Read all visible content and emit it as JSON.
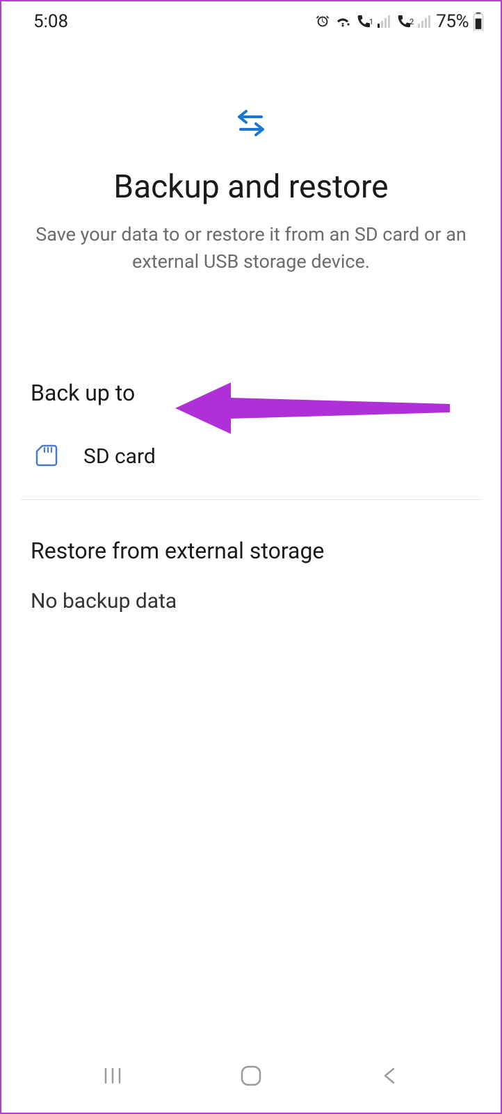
{
  "status": {
    "time": "5:08",
    "battery_pct": "75%"
  },
  "hero": {
    "title": "Backup and restore",
    "subtitle": "Save your data to or restore it from an SD card or an external USB storage device."
  },
  "backup": {
    "header": "Back up to",
    "option_label": "SD card"
  },
  "restore": {
    "header": "Restore from external storage",
    "no_data": "No backup data"
  },
  "colors": {
    "icon_blue": "#1976d2",
    "arrow_purple": "#b030d8"
  }
}
